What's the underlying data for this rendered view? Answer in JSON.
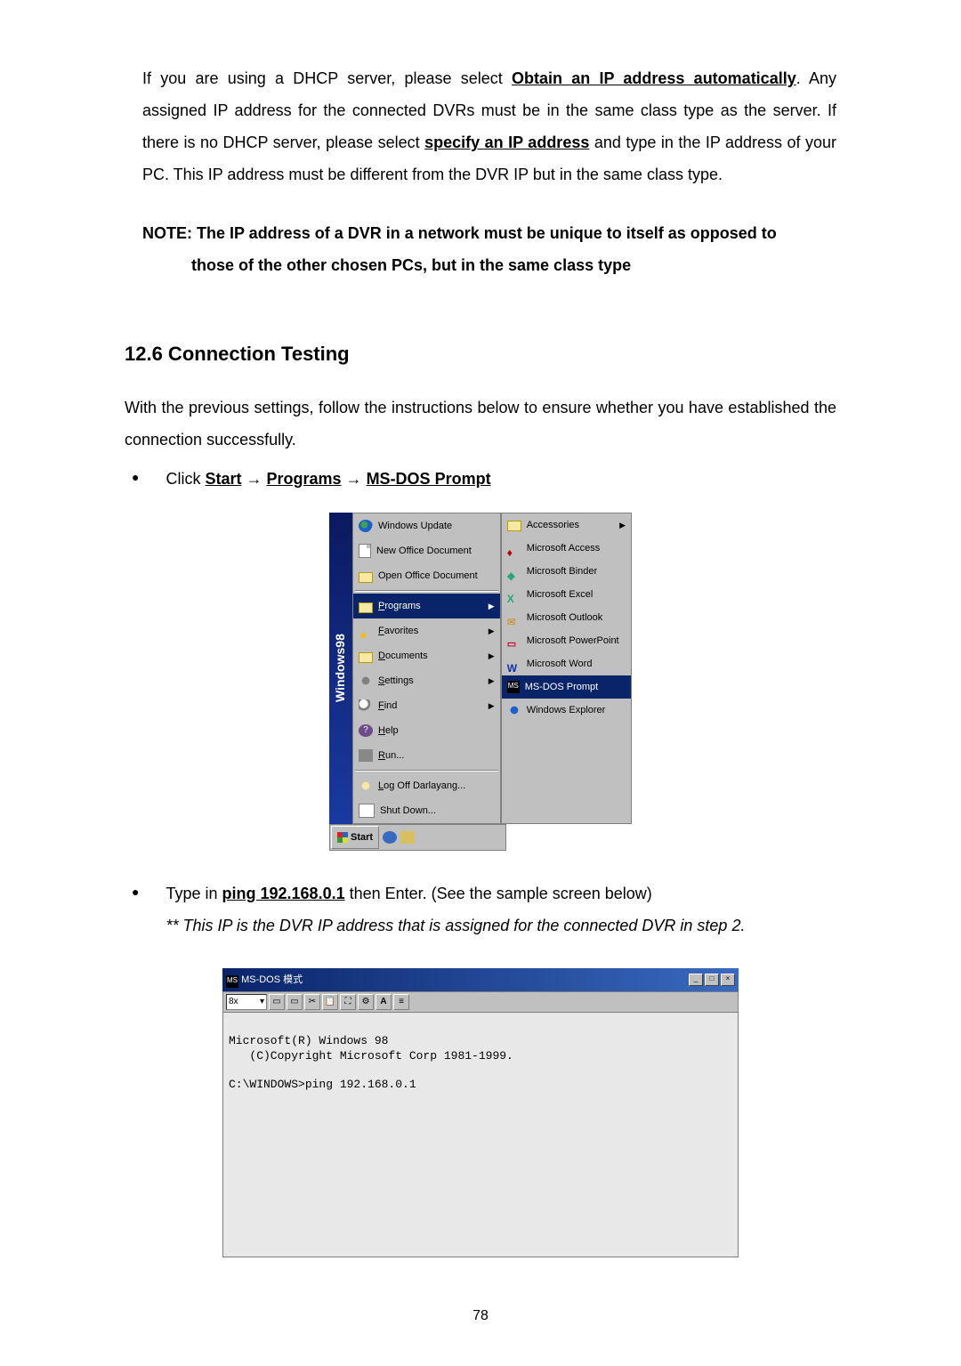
{
  "para1": {
    "t1": "If you are using a DHCP server, please select ",
    "link1": "Obtain an IP address automatically",
    "t2": ". Any assigned IP address for the connected DVRs must be in the same class type as the server. If there is no DHCP server, please select ",
    "link2": "specify an IP address",
    "t3": " and type in the IP address of your PC. This IP address must be different from the DVR IP but in the same class type."
  },
  "note": {
    "line1": "NOTE: The IP address of a DVR in a network must be unique to itself as opposed to",
    "line2": "those of the other chosen PCs, but in the same class type"
  },
  "section_title": "12.6 Connection Testing",
  "para2": "With the previous settings, follow the instructions below to ensure whether you have established the connection successfully.",
  "bullet1": {
    "pre": "Click ",
    "start": "Start",
    "arr1": " → ",
    "programs": "Programs",
    "arr2": " → ",
    "msdos": "MS-DOS Prompt"
  },
  "startmenu": {
    "banner": "Windows98",
    "top_items": [
      "Windows Update",
      "New Office Document",
      "Open Office Document"
    ],
    "main_items": [
      {
        "label": "Programs",
        "arrow": true,
        "hl": true
      },
      {
        "label": "Favorites",
        "arrow": true
      },
      {
        "label": "Documents",
        "arrow": true
      },
      {
        "label": "Settings",
        "arrow": true
      },
      {
        "label": "Find",
        "arrow": true
      },
      {
        "label": "Help",
        "arrow": false
      },
      {
        "label": "Run...",
        "arrow": false
      }
    ],
    "bottom_items": [
      "Log Off Darlayang...",
      "Shut Down..."
    ],
    "taskbar_start": "Start",
    "submenu": [
      {
        "label": "Accessories",
        "arrow": true
      },
      {
        "label": "Microsoft Access"
      },
      {
        "label": "Microsoft Binder"
      },
      {
        "label": "Microsoft Excel"
      },
      {
        "label": "Microsoft Outlook"
      },
      {
        "label": "Microsoft PowerPoint"
      },
      {
        "label": "Microsoft Word"
      },
      {
        "label": "MS-DOS Prompt",
        "hl": true
      },
      {
        "label": "Windows Explorer"
      }
    ]
  },
  "bullet2": {
    "pre": "Type in ",
    "cmd": "ping 192.168.0.1",
    "post": " then Enter. (See the sample screen below)",
    "note": "** This IP is the DVR IP address that is assigned for the connected DVR in step 2."
  },
  "dos": {
    "title": "MS-DOS 模式",
    "toolbar_sel": "8x",
    "line1": "Microsoft(R) Windows 98",
    "line2": "   (C)Copyright Microsoft Corp 1981-1999.",
    "line3": "C:\\WINDOWS>ping 192.168.0.1"
  },
  "page_number": "78"
}
